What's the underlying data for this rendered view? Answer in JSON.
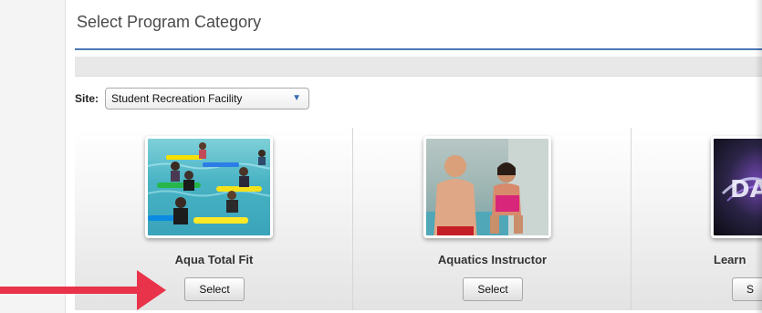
{
  "header": {
    "title": "Select Program Category"
  },
  "site": {
    "label": "Site:",
    "selected": "Student Recreation Facility",
    "caret_icon": "triangle-down"
  },
  "categories": [
    {
      "name": "Aqua Total Fit",
      "button": "Select",
      "image": "aqua-fitness-class-photo"
    },
    {
      "name": "Aquatics Instructor",
      "button": "Select",
      "image": "swim-instructor-photo"
    },
    {
      "name": "Learn",
      "button": "S",
      "image": "dance-graphic-photo"
    }
  ],
  "annotation": {
    "arrow_color": "#e8334a",
    "icon": "right-arrow"
  },
  "colors": {
    "accent_rule": "#4a78b5",
    "caret": "#3c6db0"
  }
}
